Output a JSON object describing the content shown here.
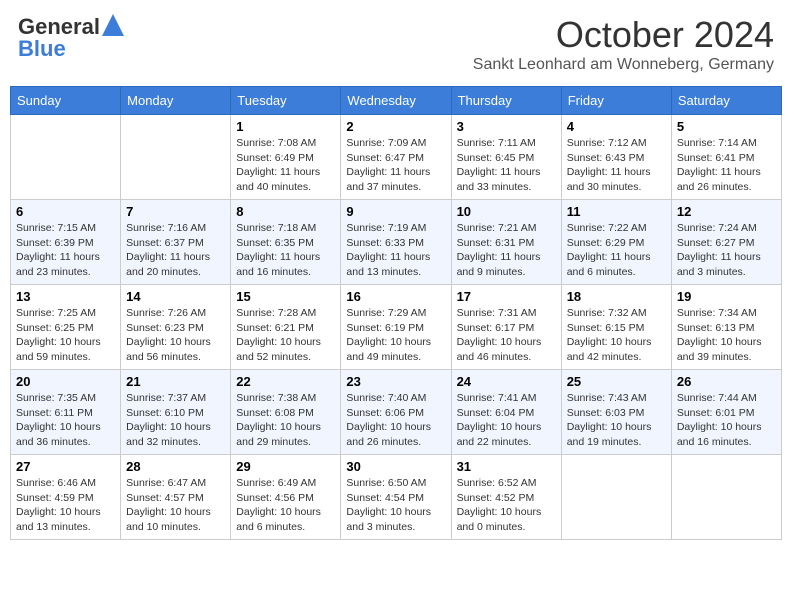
{
  "header": {
    "logo_general": "General",
    "logo_blue": "Blue",
    "month_year": "October 2024",
    "location": "Sankt Leonhard am Wonneberg, Germany"
  },
  "weekdays": [
    "Sunday",
    "Monday",
    "Tuesday",
    "Wednesday",
    "Thursday",
    "Friday",
    "Saturday"
  ],
  "weeks": [
    [
      {
        "day": "",
        "info": ""
      },
      {
        "day": "",
        "info": ""
      },
      {
        "day": "1",
        "info": "Sunrise: 7:08 AM\nSunset: 6:49 PM\nDaylight: 11 hours and 40 minutes."
      },
      {
        "day": "2",
        "info": "Sunrise: 7:09 AM\nSunset: 6:47 PM\nDaylight: 11 hours and 37 minutes."
      },
      {
        "day": "3",
        "info": "Sunrise: 7:11 AM\nSunset: 6:45 PM\nDaylight: 11 hours and 33 minutes."
      },
      {
        "day": "4",
        "info": "Sunrise: 7:12 AM\nSunset: 6:43 PM\nDaylight: 11 hours and 30 minutes."
      },
      {
        "day": "5",
        "info": "Sunrise: 7:14 AM\nSunset: 6:41 PM\nDaylight: 11 hours and 26 minutes."
      }
    ],
    [
      {
        "day": "6",
        "info": "Sunrise: 7:15 AM\nSunset: 6:39 PM\nDaylight: 11 hours and 23 minutes."
      },
      {
        "day": "7",
        "info": "Sunrise: 7:16 AM\nSunset: 6:37 PM\nDaylight: 11 hours and 20 minutes."
      },
      {
        "day": "8",
        "info": "Sunrise: 7:18 AM\nSunset: 6:35 PM\nDaylight: 11 hours and 16 minutes."
      },
      {
        "day": "9",
        "info": "Sunrise: 7:19 AM\nSunset: 6:33 PM\nDaylight: 11 hours and 13 minutes."
      },
      {
        "day": "10",
        "info": "Sunrise: 7:21 AM\nSunset: 6:31 PM\nDaylight: 11 hours and 9 minutes."
      },
      {
        "day": "11",
        "info": "Sunrise: 7:22 AM\nSunset: 6:29 PM\nDaylight: 11 hours and 6 minutes."
      },
      {
        "day": "12",
        "info": "Sunrise: 7:24 AM\nSunset: 6:27 PM\nDaylight: 11 hours and 3 minutes."
      }
    ],
    [
      {
        "day": "13",
        "info": "Sunrise: 7:25 AM\nSunset: 6:25 PM\nDaylight: 10 hours and 59 minutes."
      },
      {
        "day": "14",
        "info": "Sunrise: 7:26 AM\nSunset: 6:23 PM\nDaylight: 10 hours and 56 minutes."
      },
      {
        "day": "15",
        "info": "Sunrise: 7:28 AM\nSunset: 6:21 PM\nDaylight: 10 hours and 52 minutes."
      },
      {
        "day": "16",
        "info": "Sunrise: 7:29 AM\nSunset: 6:19 PM\nDaylight: 10 hours and 49 minutes."
      },
      {
        "day": "17",
        "info": "Sunrise: 7:31 AM\nSunset: 6:17 PM\nDaylight: 10 hours and 46 minutes."
      },
      {
        "day": "18",
        "info": "Sunrise: 7:32 AM\nSunset: 6:15 PM\nDaylight: 10 hours and 42 minutes."
      },
      {
        "day": "19",
        "info": "Sunrise: 7:34 AM\nSunset: 6:13 PM\nDaylight: 10 hours and 39 minutes."
      }
    ],
    [
      {
        "day": "20",
        "info": "Sunrise: 7:35 AM\nSunset: 6:11 PM\nDaylight: 10 hours and 36 minutes."
      },
      {
        "day": "21",
        "info": "Sunrise: 7:37 AM\nSunset: 6:10 PM\nDaylight: 10 hours and 32 minutes."
      },
      {
        "day": "22",
        "info": "Sunrise: 7:38 AM\nSunset: 6:08 PM\nDaylight: 10 hours and 29 minutes."
      },
      {
        "day": "23",
        "info": "Sunrise: 7:40 AM\nSunset: 6:06 PM\nDaylight: 10 hours and 26 minutes."
      },
      {
        "day": "24",
        "info": "Sunrise: 7:41 AM\nSunset: 6:04 PM\nDaylight: 10 hours and 22 minutes."
      },
      {
        "day": "25",
        "info": "Sunrise: 7:43 AM\nSunset: 6:03 PM\nDaylight: 10 hours and 19 minutes."
      },
      {
        "day": "26",
        "info": "Sunrise: 7:44 AM\nSunset: 6:01 PM\nDaylight: 10 hours and 16 minutes."
      }
    ],
    [
      {
        "day": "27",
        "info": "Sunrise: 6:46 AM\nSunset: 4:59 PM\nDaylight: 10 hours and 13 minutes."
      },
      {
        "day": "28",
        "info": "Sunrise: 6:47 AM\nSunset: 4:57 PM\nDaylight: 10 hours and 10 minutes."
      },
      {
        "day": "29",
        "info": "Sunrise: 6:49 AM\nSunset: 4:56 PM\nDaylight: 10 hours and 6 minutes."
      },
      {
        "day": "30",
        "info": "Sunrise: 6:50 AM\nSunset: 4:54 PM\nDaylight: 10 hours and 3 minutes."
      },
      {
        "day": "31",
        "info": "Sunrise: 6:52 AM\nSunset: 4:52 PM\nDaylight: 10 hours and 0 minutes."
      },
      {
        "day": "",
        "info": ""
      },
      {
        "day": "",
        "info": ""
      }
    ]
  ]
}
